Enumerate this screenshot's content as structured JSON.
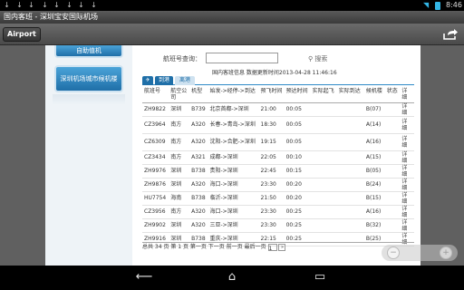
{
  "status_bar": {
    "notifications": [
      "↓",
      "↓",
      "↓",
      "↓",
      "↓",
      "↓",
      "↓",
      "↓"
    ],
    "wifi_icon": "wifi-icon",
    "battery_icon": "battery-icon",
    "time": "8:46"
  },
  "window_title": "国内客班 - 深圳宝安国际机场",
  "app_bar": {
    "app_button_label": "Airport",
    "share_icon": "share-icon"
  },
  "sidebar": {
    "buttons": [
      "自助值机",
      "深圳机场城市候机楼"
    ]
  },
  "search": {
    "label": "航班号查询：",
    "value": "",
    "button_label": "搜索",
    "button_icon": "search-icon"
  },
  "info_text": "国内客班信息 数据更新时间2013-04-28 11:46:16",
  "tabs": {
    "plane_icon": "plane-icon",
    "items": [
      "到港",
      "离港"
    ],
    "active_index": 0
  },
  "table": {
    "headers": [
      "航班号",
      "航空公司",
      "机型",
      "始发->经停->到达",
      "预飞时间",
      "预达时间",
      "实际起飞",
      "实际到达",
      "候机楼",
      "状态",
      "详细"
    ],
    "rows": [
      [
        "ZH9822",
        "深圳",
        "B739",
        "北京首都->深圳",
        "21:00",
        "00:05",
        "",
        "",
        "B(07)",
        "",
        "详细"
      ],
      [
        "CZ3964",
        "南方",
        "A320",
        "长春->青岛->深圳",
        "18:30",
        "00:05",
        "",
        "",
        "A(14)",
        "",
        "详细"
      ],
      [
        "CZ6309",
        "南方",
        "A320",
        "沈阳->合肥->深圳",
        "19:15",
        "00:05",
        "",
        "",
        "A(16)",
        "",
        "详细"
      ],
      [
        "CZ3434",
        "南方",
        "A321",
        "成都->深圳",
        "22:05",
        "00:10",
        "",
        "",
        "A(15)",
        "",
        "详细"
      ],
      [
        "ZH9976",
        "深圳",
        "B738",
        "贵阳->深圳",
        "22:45",
        "00:15",
        "",
        "",
        "B(05)",
        "",
        "详细"
      ],
      [
        "ZH9876",
        "深圳",
        "A320",
        "海口->深圳",
        "23:30",
        "00:20",
        "",
        "",
        "B(24)",
        "",
        "详细"
      ],
      [
        "HU7754",
        "海南",
        "B738",
        "临沂->深圳",
        "21:50",
        "00:20",
        "",
        "",
        "B(15)",
        "",
        "详细"
      ],
      [
        "CZ3956",
        "南方",
        "A320",
        "海口->深圳",
        "23:30",
        "00:25",
        "",
        "",
        "A(16)",
        "",
        "详细"
      ],
      [
        "ZH9902",
        "深圳",
        "A320",
        "三亚->深圳",
        "23:30",
        "00:25",
        "",
        "",
        "B(32)",
        "",
        "详细"
      ],
      [
        "ZH9916",
        "深圳",
        "B738",
        "重庆->深圳",
        "22:15",
        "00:25",
        "",
        "",
        "B(25)",
        "",
        "详细"
      ]
    ]
  },
  "pager": {
    "text": "总共 34 页 第 1 页 第一页 下一页 前一页 最后一页",
    "page_value": "1",
    "go_label": "»"
  },
  "zoom": {
    "zoom_out_icon": "zoom-out-icon",
    "zoom_in_icon": "zoom-in-icon",
    "zoom_out_label": "−",
    "zoom_in_label": "+"
  },
  "nav_bar": {
    "back_icon": "back-icon",
    "home_icon": "home-icon",
    "recents_icon": "recents-icon",
    "back_glyph": "⟵",
    "home_glyph": "⌂",
    "recents_glyph": "▭"
  }
}
